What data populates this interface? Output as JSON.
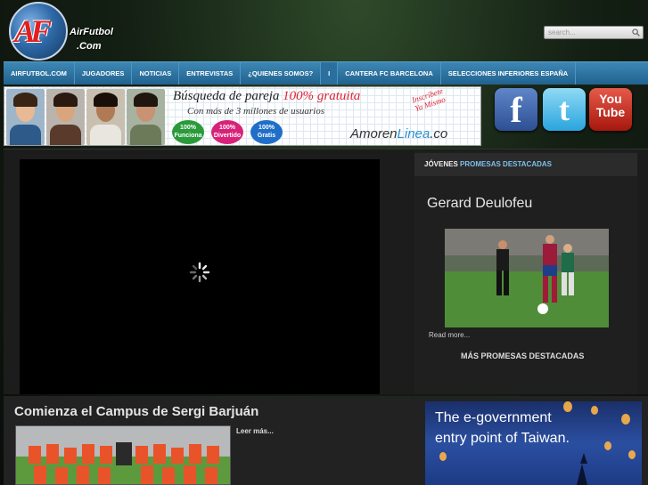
{
  "header": {
    "logo_letters": "AF",
    "logo_name": "AirFutbol",
    "logo_tld": ".Com",
    "search_placeholder": "search..."
  },
  "nav": {
    "items": [
      {
        "label": "AIRFUTBOL.COM"
      },
      {
        "label": "JUGADORES"
      },
      {
        "label": "NOTICIAS"
      },
      {
        "label": "ENTREVISTAS"
      },
      {
        "label": "¿QUIENES SOMOS?"
      },
      {
        "label": "I"
      },
      {
        "label": "CANTERA FC BARCELONA"
      },
      {
        "label": "SELECCIONES INFERIORES ESPAÑA"
      }
    ]
  },
  "banner": {
    "headline_pre": "Búsqueda de pareja ",
    "headline_highlight": "100% gratuita",
    "subline": "Con más de 3 millones de usuarios",
    "circles": [
      {
        "pct": "100%",
        "word": "Funciona",
        "color": "#2a9a3a"
      },
      {
        "pct": "100%",
        "word": "Divertido",
        "color": "#d8227a"
      },
      {
        "pct": "100%",
        "word": "Gratis",
        "color": "#1f6fc8"
      }
    ],
    "stamp_line1": "Inscríbete",
    "stamp_line2": "Ya Mismo",
    "brand_a": "Amoren",
    "brand_b": "Linea",
    "brand_c": ".co"
  },
  "social": {
    "facebook": "f",
    "twitter": "t",
    "youtube_a": "You",
    "youtube_b": "Tube"
  },
  "sidebar": {
    "heading_a": "JÓVENES",
    "heading_b": "PROMESAS DESTACADAS",
    "player_name": "Gerard Deulofeu",
    "read_more": "Read more...",
    "more_link": "MÁS PROMESAS DESTACADAS"
  },
  "article": {
    "title": "Comienza el Campus de Sergi Barjuán",
    "more": "Leer más..."
  },
  "ad": {
    "line1": "The e-government",
    "line2": "entry point of Taiwan."
  }
}
